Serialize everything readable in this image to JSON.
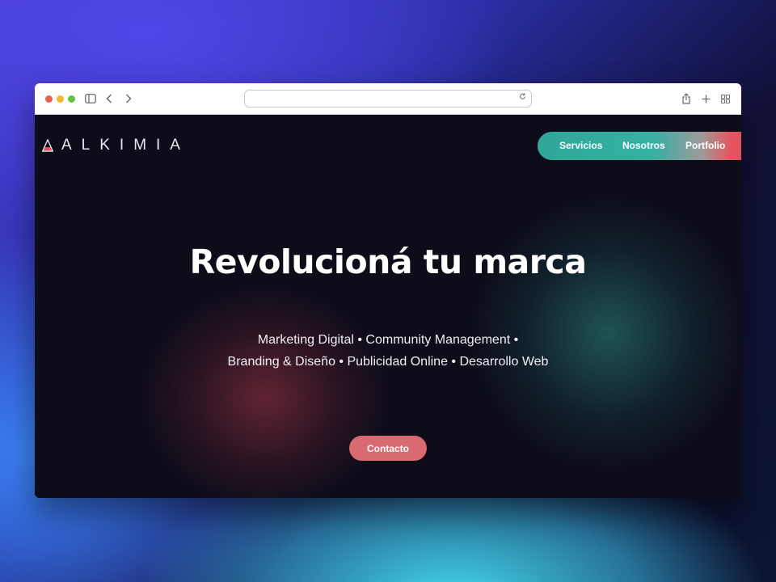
{
  "site": {
    "logo_text": "ALKIMIA"
  },
  "nav": {
    "items": [
      {
        "label": "Servicios"
      },
      {
        "label": "Nosotros"
      },
      {
        "label": "Portfolio"
      }
    ]
  },
  "hero": {
    "title": "Revolucioná tu marca",
    "services_line1": "Marketing Digital • Community Management •",
    "services_line2": "Branding & Diseño • Publicidad Online • Desarrollo Web",
    "cta_label": "Contacto"
  },
  "browser": {
    "url": ""
  },
  "colors": {
    "nav_teal": "#36b0a3",
    "nav_coral": "#e8555f",
    "cta": "#d96a72",
    "page_bg": "#0d0c19"
  },
  "icons": [
    "sidebar-icon",
    "back-icon",
    "forward-icon",
    "reload-icon",
    "share-icon",
    "new-tab-icon",
    "tab-overview-icon",
    "logo-flask-icon"
  ]
}
